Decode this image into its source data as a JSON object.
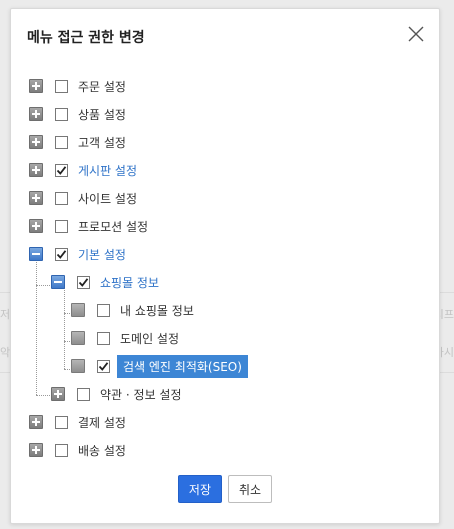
{
  "background": {
    "right_top": "시프",
    "right_bottom": "가시",
    "left_top": "저",
    "left_bottom": "악"
  },
  "modal": {
    "title": "메뉴 접근 권한 변경",
    "close_icon": "close-icon"
  },
  "tree": [
    {
      "label": "주문 설정",
      "checked": false,
      "state": "collapsed"
    },
    {
      "label": "상품 설정",
      "checked": false,
      "state": "collapsed"
    },
    {
      "label": "고객 설정",
      "checked": false,
      "state": "collapsed"
    },
    {
      "label": "게시판 설정",
      "checked": true,
      "state": "collapsed",
      "active": true
    },
    {
      "label": "사이트 설정",
      "checked": false,
      "state": "collapsed"
    },
    {
      "label": "프로모션 설정",
      "checked": false,
      "state": "collapsed"
    },
    {
      "label": "기본 설정",
      "checked": true,
      "state": "expanded",
      "active": true,
      "children": [
        {
          "label": "쇼핑몰 정보",
          "checked": true,
          "state": "expanded",
          "active": true,
          "children": [
            {
              "label": "내 쇼핑몰 정보",
              "checked": false
            },
            {
              "label": "도메인 설정",
              "checked": false
            },
            {
              "label": "검색 엔진 최적화(SEO)",
              "checked": true,
              "selected": true
            }
          ]
        },
        {
          "label": "약관 · 정보 설정",
          "checked": false,
          "state": "collapsed"
        }
      ]
    },
    {
      "label": "결제 설정",
      "checked": false,
      "state": "collapsed"
    },
    {
      "label": "배송 설정",
      "checked": false,
      "state": "collapsed"
    }
  ],
  "buttons": {
    "save": "저장",
    "cancel": "취소"
  },
  "colors": {
    "primary": "#2b6fe0",
    "active_text": "#2f73c8",
    "selected_bg": "#3d86d5"
  }
}
